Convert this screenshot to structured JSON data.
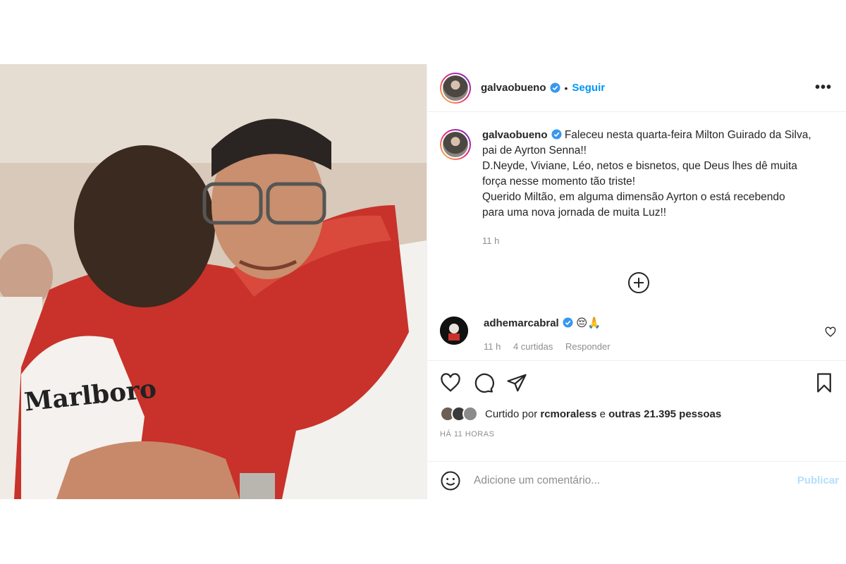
{
  "post": {
    "author": "galvaobueno",
    "follow_label": "Seguir",
    "separator": "•",
    "more_label": "•••",
    "photo_text": "Marlboro",
    "caption": {
      "username": "galvaobueno",
      "lines": [
        "Faleceu nesta quarta-feira Milton Guirado da Silva,",
        "pai de Ayrton Senna!!",
        "D.Neyde, Viviane, Léo, netos e bisnetos, que Deus lhes dê muita",
        "força nesse momento tão triste!",
        "Querido Miltão, em alguma dimensão Ayrton o está recebendo",
        "para uma nova jornada de muita Luz!!"
      ],
      "time": "11 h"
    },
    "comment": {
      "username": "adhemarcabral",
      "text": "😔🙏",
      "time": "11 h",
      "likes": "4 curtidas",
      "reply": "Responder"
    },
    "liked_by": {
      "prefix": "Curtido por",
      "user": "rcmoraless",
      "connector": "e",
      "others": "outras 21.395 pessoas"
    },
    "time_ago": "HÁ 11 HORAS",
    "add_comment_placeholder": "Adicione um comentário...",
    "publish_label": "Publicar"
  },
  "colors": {
    "accent": "#0095f6",
    "publish_disabled": "#b2dffc",
    "verified": "#3897f0",
    "muted": "#8e8e8e"
  }
}
